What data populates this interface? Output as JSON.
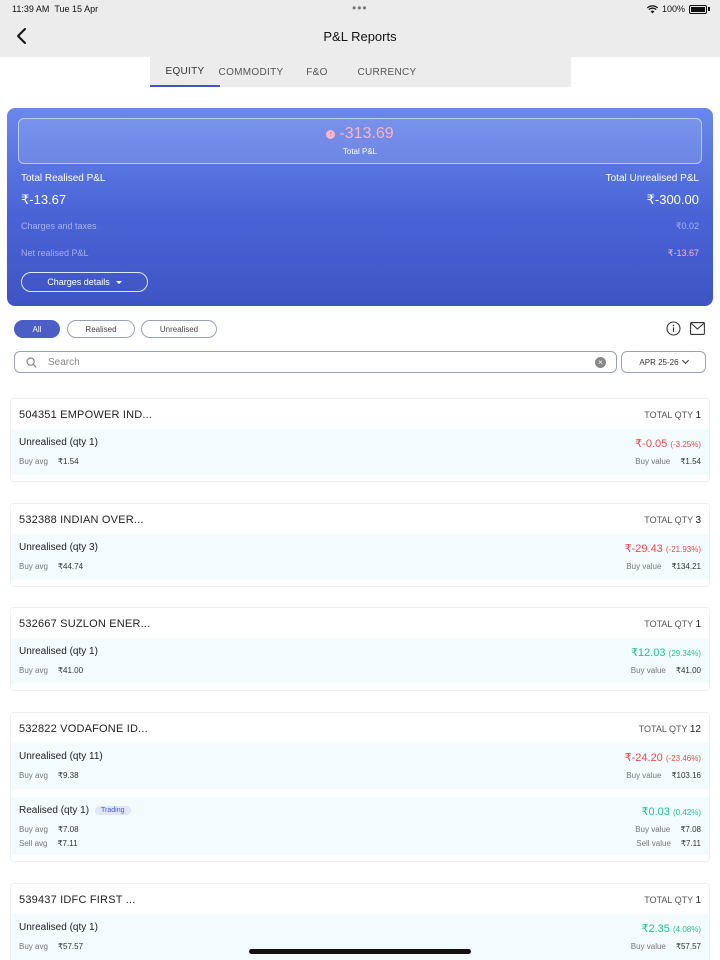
{
  "status": {
    "time": "11:39 AM",
    "date": "Tue 15 Apr",
    "battery": "100%"
  },
  "header": {
    "title": "P&L Reports"
  },
  "tabs": [
    "EQUITY",
    "COMMODITY",
    "F&O",
    "CURRENCY"
  ],
  "summary": {
    "total_pnl": "-313.69",
    "total_pnl_label": "Total P&L",
    "realised_label": "Total Realised P&L",
    "realised_value": "₹-13.67",
    "unrealised_label": "Total Unrealised P&L",
    "unrealised_value": "₹-300.00",
    "charges_label": "Charges and taxes",
    "charges_value": "₹0.02",
    "net_label": "Net realised P&L",
    "net_value": "₹-13.67",
    "charges_button": "Charges details"
  },
  "filters": {
    "all": "All",
    "realised": "Realised",
    "unrealised": "Unrealised"
  },
  "search": {
    "placeholder": "Search"
  },
  "year": "APR 25-26",
  "labels": {
    "total_qty": "TOTAL QTY",
    "buy_avg": "Buy avg",
    "buy_value": "Buy value",
    "sell_avg": "Sell avg",
    "sell_value": "Sell value"
  },
  "holdings": [
    {
      "name": "504351 EMPOWER IND...",
      "qty": "1",
      "rows": [
        {
          "title": "Unrealised (qty 1)",
          "pnl": "₹-0.05",
          "pct": "(-3.25%)",
          "buy_avg": "₹1.54",
          "buy_value": "₹1.54"
        }
      ]
    },
    {
      "name": "532388 INDIAN OVER...",
      "qty": "3",
      "rows": [
        {
          "title": "Unrealised (qty 3)",
          "pnl": "₹-29.43",
          "pct": "(-21.93%)",
          "buy_avg": "₹44.74",
          "buy_value": "₹134.21"
        }
      ]
    },
    {
      "name": "532667 SUZLON ENER...",
      "qty": "1",
      "rows": [
        {
          "title": "Unrealised (qty 1)",
          "pnl": "₹12.03",
          "pct": "(29.34%)",
          "buy_avg": "₹41.00",
          "buy_value": "₹41.00"
        }
      ]
    },
    {
      "name": "532822 VODAFONE ID...",
      "qty": "12",
      "rows": [
        {
          "title": "Unrealised (qty 11)",
          "pnl": "₹-24.20",
          "pct": "(-23.46%)",
          "buy_avg": "₹9.38",
          "buy_value": "₹103.16"
        },
        {
          "title": "Realised (qty 1)",
          "badge": "Trading",
          "pnl": "₹0.03",
          "pct": "(0.42%)",
          "buy_avg": "₹7.08",
          "buy_value": "₹7.08",
          "sell_avg": "₹7.11",
          "sell_value": "₹7.11"
        }
      ]
    },
    {
      "name": "539437 IDFC FIRST ...",
      "qty": "1",
      "rows": [
        {
          "title": "Unrealised (qty 1)",
          "pnl": "₹2.35",
          "pct": "(4.08%)",
          "buy_avg": "₹57.57",
          "buy_value": "₹57.57"
        }
      ]
    }
  ],
  "colors": {
    "accent": "#4b5ec6",
    "negative": "#e8474e",
    "positive": "#1fbf8e"
  }
}
